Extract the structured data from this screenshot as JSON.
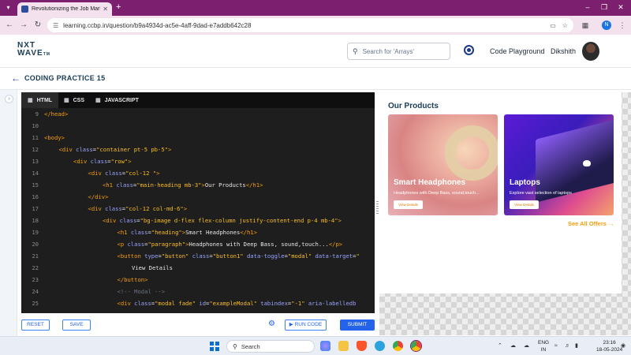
{
  "browser": {
    "tab_title": "Revolutionizing the Job Market",
    "url": "learning.ccbp.in/question/b9a4934d-ac5e-4aff-9dad-e7addb642c28",
    "profile_initial": "N"
  },
  "header": {
    "logo_line1": "NXT",
    "logo_line2": "WAVE",
    "logo_tm": "TM",
    "search_placeholder": "Search for 'Arrays'",
    "code_playground": "Code Playground",
    "user_name": "Dikshith"
  },
  "practice": {
    "title": "CODING PRACTICE 15"
  },
  "editor": {
    "tabs": [
      {
        "label": "HTML",
        "active": true
      },
      {
        "label": "CSS",
        "active": false
      },
      {
        "label": "JAVASCRIPT",
        "active": false
      }
    ],
    "lines": [
      {
        "n": "9",
        "indent": 0,
        "html": "<span class='tag'>&lt;/head&gt;</span>"
      },
      {
        "n": "10",
        "indent": 0,
        "html": ""
      },
      {
        "n": "11",
        "indent": 0,
        "html": "<span class='tag'>&lt;body&gt;</span>"
      },
      {
        "n": "12",
        "indent": 1,
        "html": "<span class='tag'>&lt;div</span> <span class='attr'>class</span>=<span class='str'>\"container pt-5 pb-5\"</span><span class='tag'>&gt;</span>"
      },
      {
        "n": "13",
        "indent": 2,
        "html": "<span class='tag'>&lt;div</span> <span class='attr'>class</span>=<span class='str'>\"row\"</span><span class='tag'>&gt;</span>"
      },
      {
        "n": "14",
        "indent": 3,
        "html": "<span class='tag'>&lt;div</span> <span class='attr'>class</span>=<span class='str'>\"col-12 \"</span><span class='tag'>&gt;</span>"
      },
      {
        "n": "15",
        "indent": 4,
        "html": "<span class='tag'>&lt;h1</span> <span class='attr'>class</span>=<span class='str'>\"main-heading mb-3\"</span><span class='tag'>&gt;</span>Our Products<span class='tag'>&lt;/h1&gt;</span>"
      },
      {
        "n": "16",
        "indent": 3,
        "html": "<span class='tag'>&lt;/div&gt;</span>"
      },
      {
        "n": "17",
        "indent": 3,
        "html": "<span class='tag'>&lt;div</span> <span class='attr'>class</span>=<span class='str'>\"col-12 col-md-6\"</span><span class='tag'>&gt;</span>"
      },
      {
        "n": "18",
        "indent": 4,
        "html": "<span class='tag'>&lt;div</span> <span class='attr'>class</span>=<span class='str'>\"bg-image d-flex flex-column justify-content-end p-4 mb-4\"</span><span class='tag'>&gt;</span>"
      },
      {
        "n": "19",
        "indent": 5,
        "html": "<span class='tag'>&lt;h1</span> <span class='attr'>class</span>=<span class='str'>\"heading\"</span><span class='tag'>&gt;</span>Smart Headphones<span class='tag'>&lt;/h1&gt;</span>"
      },
      {
        "n": "20",
        "indent": 5,
        "html": "<span class='tag'>&lt;p</span> <span class='attr'>class</span>=<span class='str'>\"paragraph\"</span><span class='tag'>&gt;</span>Headphones with Deep Bass, sound,touch...<span class='tag'>&lt;/p&gt;</span>"
      },
      {
        "n": "21",
        "indent": 5,
        "html": "<span class='tag'>&lt;button</span> <span class='attr'>type</span>=<span class='str'>\"button\"</span> <span class='attr'>class</span>=<span class='str'>\"button1\"</span> <span class='attr'>data-toggle</span>=<span class='str'>\"modal\"</span> <span class='attr'>data-target</span>=<span class='str'>\"</span>"
      },
      {
        "n": "22",
        "indent": 6,
        "html": "View Details"
      },
      {
        "n": "23",
        "indent": 5,
        "html": "<span class='tag'>&lt;/button&gt;</span>"
      },
      {
        "n": "24",
        "indent": 5,
        "html": "<span class='cmt'>&lt;!-- Modal --&gt;</span>"
      },
      {
        "n": "25",
        "indent": 5,
        "html": "<span class='tag'>&lt;div</span> <span class='attr'>class</span>=<span class='str'>\"modal fade\"</span> <span class='attr'>id</span>=<span class='str'>\"exampleModal\"</span> <span class='attr'>tabindex</span>=<span class='str'>\"-1\"</span> <span class='attr'>aria-labelledb</span>"
      }
    ],
    "reset_label": "RESET",
    "save_label": "SAVE",
    "run_label": "RUN CODE",
    "submit_label": "SUBMIT"
  },
  "preview": {
    "title": "Our Products",
    "cards": [
      {
        "heading": "Smart Headphones",
        "text": "Headphones with Deep Bass, sound,touch...",
        "button": "View Details"
      },
      {
        "heading": "Laptops",
        "text": "Explore vast selection of laptops",
        "button": "View Details"
      }
    ],
    "see_all": "See All Offers →"
  },
  "taskbar": {
    "search_label": "Search",
    "lang_line1": "ENG",
    "lang_line2": "IN",
    "time": "23:16",
    "date": "18-05-2024"
  },
  "colors": {
    "chrome_accent": "#7b1f6e",
    "brand_navy": "#183b56",
    "primary_blue": "#2563eb",
    "offer_orange": "#f59e0b"
  }
}
